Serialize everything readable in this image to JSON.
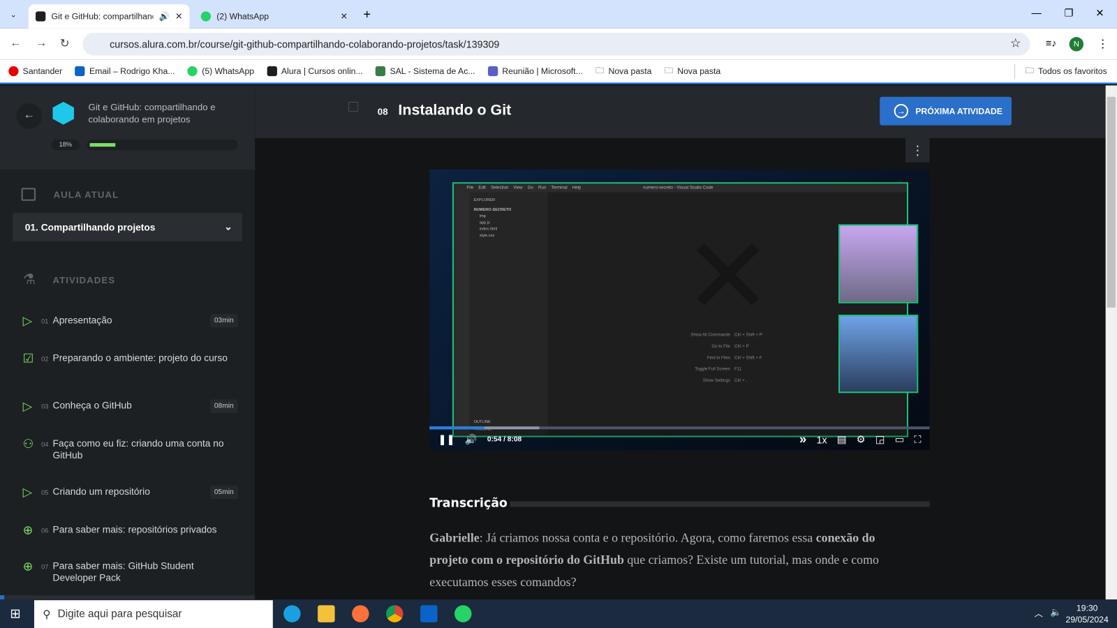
{
  "browser": {
    "tabs": [
      {
        "title": "Git e GitHub: compartilhand",
        "active": true,
        "icon": "alura-icon",
        "audio": true
      },
      {
        "title": "(2) WhatsApp",
        "active": false,
        "icon": "whatsapp-icon"
      }
    ],
    "url": "cursos.alura.com.br/course/git-github-compartilhando-colaborando-projetos/task/139309",
    "profile_initial": "N",
    "bookmarks": [
      "Santander",
      "Email – Rodrigo Kha...",
      "(5) WhatsApp",
      "Alura | Cursos onlin...",
      "SAL - Sistema de Ac...",
      "Reunião | Microsoft...",
      "Nova pasta",
      "Nova pasta"
    ],
    "all_bookmarks": "Todos os favoritos"
  },
  "sidebar": {
    "course_title": "Git e GitHub: compartilhando e colaborando em projetos",
    "progress_label": "18%",
    "progress": 0.18,
    "current_section_label": "AULA ATUAL",
    "current_lesson": "01. Compartilhando projetos",
    "activities_label": "ATIVIDADES",
    "activities": [
      {
        "num": "01",
        "title": "Apresentação",
        "duration": "03min",
        "icon": "video-icon"
      },
      {
        "num": "02",
        "title": "Preparando o ambiente: projeto do curso",
        "duration": "",
        "icon": "clipboard-icon"
      },
      {
        "num": "03",
        "title": "Conheça o GitHub",
        "duration": "08min",
        "icon": "video-icon"
      },
      {
        "num": "04",
        "title": "Faça como eu fiz: criando uma conta no GitHub",
        "duration": "",
        "icon": "people-icon"
      },
      {
        "num": "05",
        "title": "Criando um repositório",
        "duration": "05min",
        "icon": "video-icon"
      },
      {
        "num": "06",
        "title": "Para saber mais: repositórios privados",
        "duration": "",
        "icon": "plus-circle-icon"
      },
      {
        "num": "07",
        "title": "Para saber mais: GitHub Student Developer Pack",
        "duration": "",
        "icon": "plus-circle-icon"
      }
    ]
  },
  "header": {
    "activity_number": "08",
    "title": "Instalando o Git",
    "next_button": "PRÓXIMA ATIVIDADE"
  },
  "video": {
    "current_time": "0:54",
    "separator": "/",
    "duration": "8:08",
    "progress": 0.11,
    "buffered": 0.22,
    "speed": "1x",
    "vscode": {
      "menu": [
        "File",
        "Edit",
        "Selection",
        "View",
        "Go",
        "Run",
        "Terminal",
        "Help"
      ],
      "window_title": "numero-secreto - Visual Studio Code",
      "explorer": "EXPLORER",
      "folder": "NUMERO-SECRETO",
      "files": [
        "img",
        "app.js",
        "index.html",
        "style.css"
      ],
      "shortcuts": [
        {
          "label": "Show All Commands",
          "keys": "Ctrl + Shift + P"
        },
        {
          "label": "Go to File",
          "keys": "Ctrl + P"
        },
        {
          "label": "Find in Files",
          "keys": "Ctrl + Shift + F"
        },
        {
          "label": "Toggle Full Screen",
          "keys": "F11"
        },
        {
          "label": "Show Settings",
          "keys": "Ctrl + ,"
        }
      ],
      "outline": "OUTLINE",
      "timeline": "TIMELINE"
    }
  },
  "transcript": {
    "heading": "Transcrição",
    "speaker": "Gabrielle",
    "p1": ": Já criamos nossa conta e o repositório. Agora, como faremos essa ",
    "bold": "conexão do projeto com o repositório do GitHub",
    "p2": " que criamos? Existe um tutorial, mas onde e como executamos esses comandos?"
  },
  "taskbar": {
    "search_placeholder": "Digite aqui para pesquisar",
    "time": "19:30",
    "date": "29/05/2024"
  },
  "colors": {
    "accent": "#2a6fc9",
    "progress": "#7ddc6a",
    "video_border": "#19c37d"
  }
}
